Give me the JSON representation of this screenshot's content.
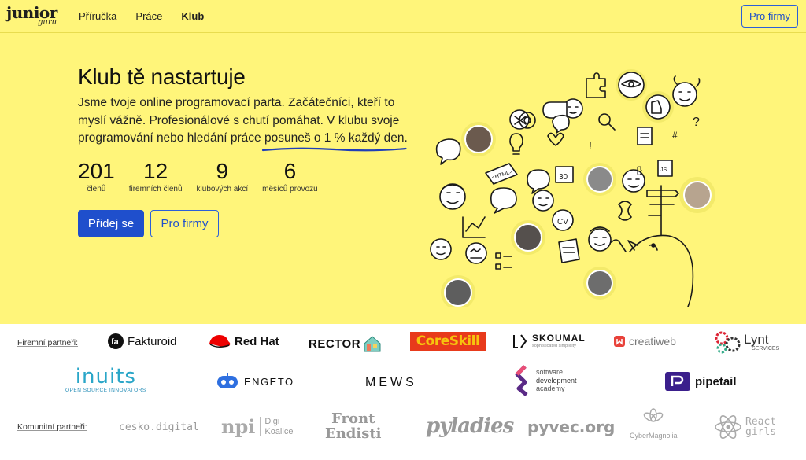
{
  "nav": {
    "logo_main": "junior",
    "logo_sub": "guru",
    "links": [
      {
        "label": "Příručka",
        "active": false
      },
      {
        "label": "Práce",
        "active": false
      },
      {
        "label": "Klub",
        "active": true
      }
    ],
    "cta": "Pro firmy"
  },
  "hero": {
    "title": "Klub tě nastartuje",
    "lead_1": "Jsme tvoje online programovací parta. Začátečníci, kteří to myslí vážně. Profesionálové s chutí pomáhat. V klubu svoje programování nebo hledání práce ",
    "lead_highlight": "posuneš o 1 % každý den",
    "lead_2": ".",
    "stats": [
      {
        "value": "201",
        "label": "členů"
      },
      {
        "value": "12",
        "label": "firemních členů"
      },
      {
        "value": "9",
        "label": "klubových akcí"
      },
      {
        "value": "6",
        "label": "měsíců provozu"
      }
    ],
    "join": "Přidej se",
    "companies": "Pro firmy",
    "highlight_color": "#1f3fb8",
    "bg_color": "#fff57a"
  },
  "partners": {
    "corporate_label": "Firemní partneři:",
    "community_label": "Komunitní partneři:",
    "corporate": [
      {
        "name": "Fakturoid",
        "icon": "fakturoid-icon"
      },
      {
        "name": "Red Hat",
        "icon": "redhat-icon"
      },
      {
        "name": "RECTOR",
        "icon": "rector-house-icon"
      },
      {
        "name": "CoreSkill",
        "icon": ""
      },
      {
        "name": "SKOUMAL",
        "sub": "sophisticated simplicity",
        "icon": "skoumal-icon"
      },
      {
        "name": "creatiweb",
        "icon": "creatiweb-icon"
      },
      {
        "name": "Lynt",
        "sub": "SERVICES",
        "icon": "lynt-gears-icon"
      },
      {
        "name": "inuits",
        "sub": "OPEN SOURCE INNOVATORS",
        "icon": ""
      },
      {
        "name": "ENGETO",
        "icon": "engeto-robot-icon"
      },
      {
        "name": "MEWS",
        "icon": ""
      },
      {
        "name": "software",
        "sub": "development",
        "sub2": "academy",
        "icon": "sda-icon"
      },
      {
        "name": "pipetail",
        "icon": "pipetail-icon"
      }
    ],
    "community": [
      {
        "name": "cesko.digital",
        "icon": "ceskodigital-icon"
      },
      {
        "name": "npi",
        "sub": "Digi",
        "sub2": "Koalice",
        "icon": ""
      },
      {
        "name": "Front",
        "sub": "Endisti",
        "icon": ""
      },
      {
        "name": "pyladies",
        "icon": ""
      },
      {
        "name": "pyvec.org",
        "icon": ""
      },
      {
        "name": "CyberMagnolia",
        "icon": "magnolia-icon"
      },
      {
        "name": "React",
        "sub": "girls",
        "icon": "react-atom-icon"
      }
    ]
  }
}
